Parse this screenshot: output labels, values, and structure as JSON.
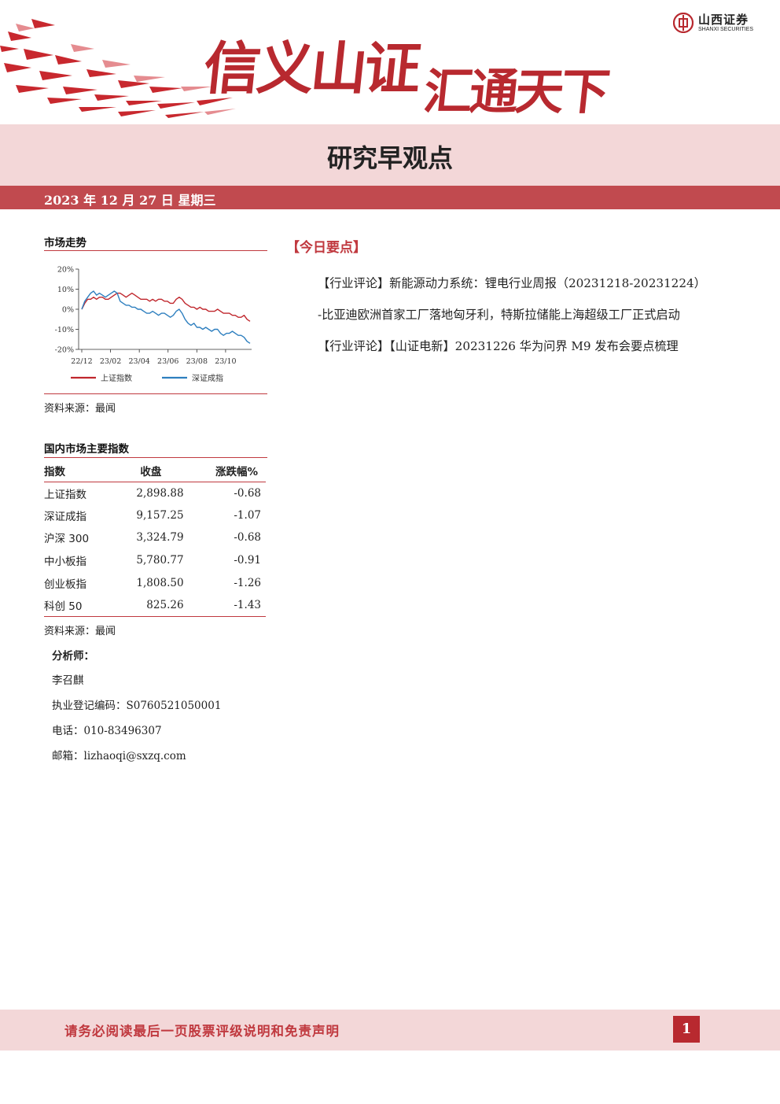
{
  "header": {
    "slogan_part1": "信义山证",
    "slogan_part2": "汇通天下",
    "logo_cn": "山西证券",
    "logo_en": "SHANXI SECURITIES"
  },
  "title": "研究早观点",
  "date": "2023 年 12 月 27 日   星期三",
  "market_trend": {
    "title": "市场走势",
    "source": "资料来源：最闻"
  },
  "chart_data": {
    "type": "line",
    "title": "",
    "xlabel": "",
    "ylabel": "",
    "x_ticks": [
      "22/12",
      "23/02",
      "23/04",
      "23/06",
      "23/08",
      "23/10"
    ],
    "y_ticks": [
      "20%",
      "10%",
      "0%",
      "-10%",
      "-20%"
    ],
    "ylim": [
      -20,
      20
    ],
    "legend_position": "bottom",
    "grid": false,
    "series": [
      {
        "name": "上证指数",
        "color": "#c0272d",
        "values": [
          0,
          3,
          5,
          5,
          6,
          5,
          6,
          6,
          5,
          5,
          6,
          7,
          8,
          8,
          7,
          6,
          7,
          8,
          7,
          6,
          5,
          5,
          5,
          4,
          5,
          4,
          5,
          5,
          4,
          4,
          3,
          3,
          5,
          6,
          5,
          3,
          2,
          1,
          1,
          0,
          1,
          0,
          0,
          -1,
          -1,
          -1,
          0,
          -1,
          -2,
          -2,
          -2,
          -3,
          -3,
          -4,
          -4,
          -3,
          -5,
          -6
        ]
      },
      {
        "name": "深证成指",
        "color": "#2e7fbf",
        "values": [
          0,
          4,
          6,
          8,
          9,
          7,
          8,
          7,
          6,
          7,
          8,
          9,
          8,
          4,
          3,
          2,
          2,
          1,
          1,
          0,
          0,
          -1,
          -2,
          -2,
          -1,
          -2,
          -3,
          -2,
          -2,
          -3,
          -4,
          -3,
          -1,
          0,
          -2,
          -5,
          -7,
          -8,
          -7,
          -9,
          -9,
          -10,
          -9,
          -10,
          -11,
          -10,
          -10,
          -12,
          -13,
          -12,
          -12,
          -11,
          -12,
          -13,
          -13,
          -14,
          -16,
          -17
        ]
      }
    ]
  },
  "index_table": {
    "title": "国内市场主要指数",
    "headers": [
      "指数",
      "收盘",
      "涨跌幅%"
    ],
    "rows": [
      {
        "name": "上证指数",
        "close": "2,898.88",
        "change": "-0.68"
      },
      {
        "name": "深证成指",
        "close": "9,157.25",
        "change": "-1.07"
      },
      {
        "name": "沪深 300",
        "close": "3,324.79",
        "change": "-0.68"
      },
      {
        "name": "中小板指",
        "close": "5,780.77",
        "change": "-0.91"
      },
      {
        "name": "创业板指",
        "close": "1,808.50",
        "change": "-1.26"
      },
      {
        "name": "科创 50",
        "close": "825.26",
        "change": "-1.43"
      }
    ],
    "source": "资料来源：最闻"
  },
  "analyst": {
    "label": "分析师：",
    "name": "李召麒",
    "registration": "执业登记编码：S0760521050001",
    "phone": "电话：010-83496307",
    "email": "邮箱：lizhaoqi@sxzq.com"
  },
  "highlights": {
    "title": "【今日要点】",
    "items": [
      "【行业评论】新能源动力系统：锂电行业周报（20231218-20231224）",
      "-比亚迪欧洲首家工厂落地匈牙利，特斯拉储能上海超级工厂正式启动",
      "【行业评论】【山证电新】20231226 华为问界 M9 发布会要点梳理"
    ]
  },
  "footer": {
    "disclaimer": "请务必阅读最后一页股票评级说明和免责声明",
    "page": "1"
  },
  "colors": {
    "brand_red": "#b8292f",
    "band_pink": "#f3d7d8",
    "date_band": "#c14a4f"
  }
}
